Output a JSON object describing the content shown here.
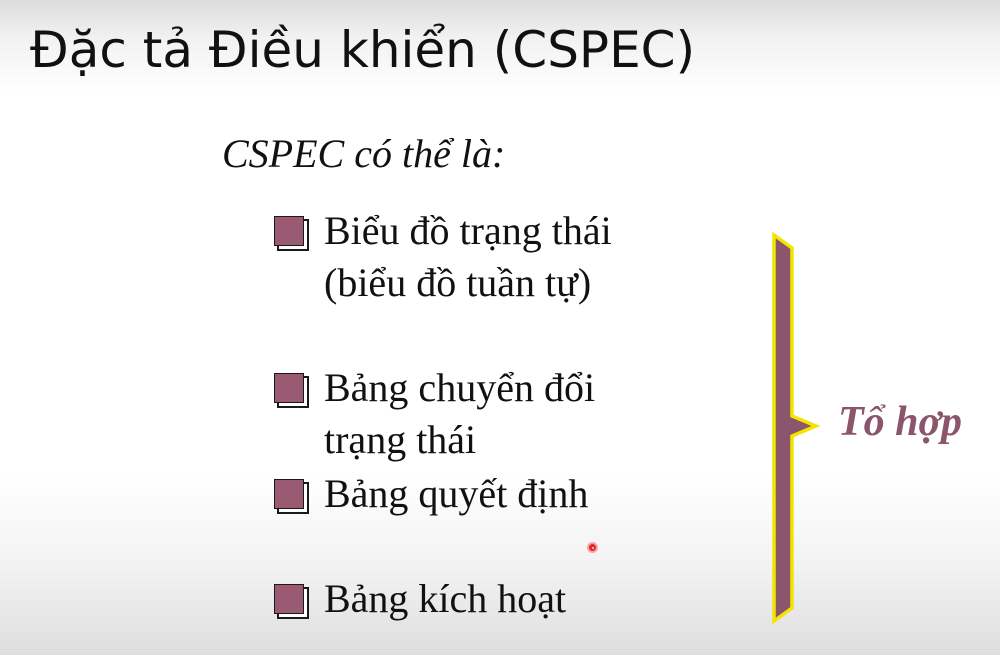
{
  "slide": {
    "title": "Đặc tả Điều khiển (CSPEC)",
    "subtitle": "CSPEC có thể là:",
    "items": [
      {
        "line1": "Biểu đồ trạng thái",
        "line2": "(biểu đồ tuần tự)"
      },
      {
        "line1": "Bảng chuyển đổi",
        "line2": "trạng thái"
      },
      {
        "line1": "Bảng quyết định"
      },
      {
        "line1": "Bảng kích hoạt"
      }
    ],
    "brace_label": "Tổ hợp",
    "colors": {
      "bullet_fill": "#9a5a72",
      "brace_fill": "#8b566b",
      "brace_outline": "#f2e600",
      "label_color": "#8b566b",
      "pointer": "#e0282a"
    }
  }
}
